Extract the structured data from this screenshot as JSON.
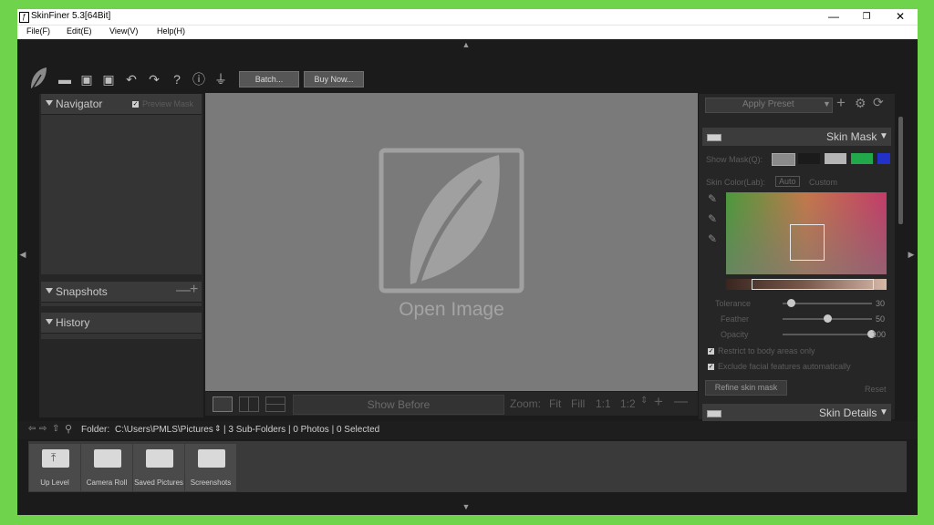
{
  "window": {
    "title": "SkinFiner 5.3[64Bit]",
    "controls": {
      "minimize": "—",
      "maximize": "❐",
      "close": "✕"
    }
  },
  "menu": [
    "File(F)",
    "Edit(E)",
    "View(V)",
    "Help(H)"
  ],
  "toolbar": {
    "batch_label": "Batch...",
    "buy_label": "Buy Now..."
  },
  "left_panel": {
    "navigator_label": "Navigator",
    "preview_mask_label": "Preview Mask",
    "snapshots_label": "Snapshots",
    "history_label": "History"
  },
  "canvas": {
    "open_image_label": "Open Image"
  },
  "bottom_bar": {
    "show_before_label": "Show Before",
    "zoom_label": "Zoom:",
    "fit": "Fit",
    "fill": "Fill",
    "one_to_one": "1:1",
    "one_to_two": "1:2"
  },
  "right_panel": {
    "apply_preset_label": "Apply Preset",
    "skin_mask_label": "Skin Mask",
    "show_mask_label": "Show Mask(Q):",
    "mask_colors": [
      "#1b1b1b",
      "#b5b5b5",
      "#21a84a",
      "#2232c8"
    ],
    "skin_color_label": "Skin Color(Lab):",
    "auto_label": "Auto",
    "custom_label": "Custom",
    "tolerance_label": "Tolerance",
    "tolerance_value": "30",
    "feather_label": "Feather",
    "feather_value": "50",
    "opacity_label": "Opacity",
    "opacity_value": "100",
    "restrict_label": "Restrict to body areas only",
    "exclude_label": "Exclude facial features automatically",
    "refine_label": "Refine skin mask",
    "reset_label": "Reset",
    "skin_details_label": "Skin Details"
  },
  "browser": {
    "folder_label": "Folder:",
    "folder_path": "C:\\Users\\PMLS\\Pictures",
    "status": "| 3 Sub-Folders | 0 Photos | 0 Selected",
    "items": [
      "Up Level",
      "Camera Roll",
      "Saved Pictures",
      "Screenshots"
    ]
  }
}
